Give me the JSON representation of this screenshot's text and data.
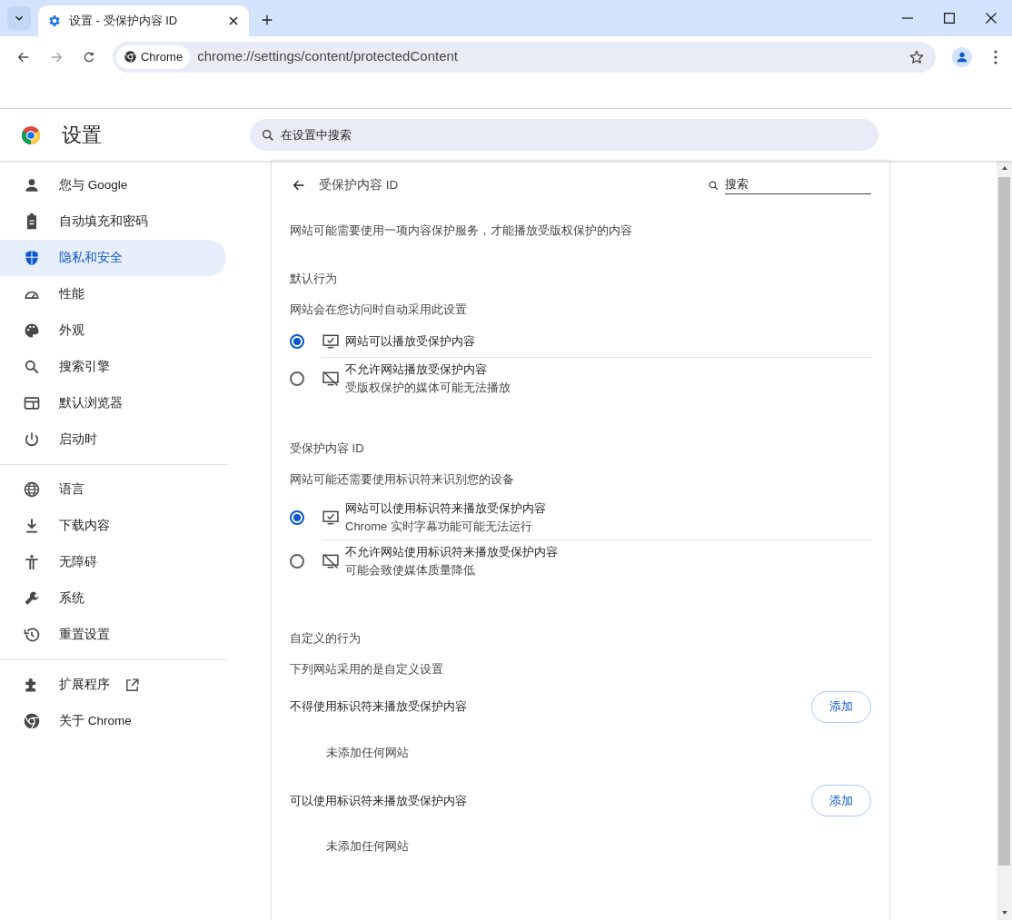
{
  "browser": {
    "tab": {
      "title": "设置 - 受保护内容 ID",
      "selected": true
    },
    "address": {
      "chip": "Chrome",
      "url": "chrome://settings/content/protectedContent"
    }
  },
  "header": {
    "title": "设置",
    "search": {
      "placeholder": "在设置中搜索"
    }
  },
  "sidebar": {
    "groups": [
      [
        {
          "label": "您与 Google",
          "selected": false,
          "external": false
        },
        {
          "label": "自动填充和密码",
          "selected": false,
          "external": false
        },
        {
          "label": "隐私和安全",
          "selected": true,
          "external": false
        },
        {
          "label": "性能",
          "selected": false,
          "external": false
        },
        {
          "label": "外观",
          "selected": false,
          "external": false
        },
        {
          "label": "搜索引擎",
          "selected": false,
          "external": false
        },
        {
          "label": "默认浏览器",
          "selected": false,
          "external": false
        },
        {
          "label": "启动时",
          "selected": false,
          "external": false
        }
      ],
      [
        {
          "label": "语言",
          "selected": false,
          "external": false
        },
        {
          "label": "下载内容",
          "selected": false,
          "external": false
        },
        {
          "label": "无障碍",
          "selected": false,
          "external": false
        },
        {
          "label": "系统",
          "selected": false,
          "external": false
        },
        {
          "label": "重置设置",
          "selected": false,
          "external": false
        }
      ],
      [
        {
          "label": "扩展程序",
          "selected": false,
          "external": true
        },
        {
          "label": "关于 Chrome",
          "selected": false,
          "external": false
        }
      ]
    ]
  },
  "page": {
    "title": "受保护内容 ID",
    "search": {
      "placeholder": "搜索"
    },
    "description": "网站可能需要使用一项内容保护服务，才能播放受版权保护的内容",
    "sections": [
      {
        "heading": "默认行为",
        "subheading": "网站会在您访问时自动采用此设置",
        "options": [
          {
            "kind": "allow",
            "selected": true,
            "title": "网站可以播放受保护内容"
          },
          {
            "kind": "block",
            "selected": false,
            "title": "不允许网站播放受保护内容",
            "subtitle": "受版权保护的媒体可能无法播放"
          }
        ]
      },
      {
        "heading": "受保护内容 ID",
        "subheading": "网站可能还需要使用标识符来识别您的设备",
        "options": [
          {
            "kind": "allow",
            "selected": true,
            "title": "网站可以使用标识符来播放受保护内容",
            "subtitle": "Chrome 实时字幕功能可能无法运行"
          },
          {
            "kind": "block",
            "selected": false,
            "title": "不允许网站使用标识符来播放受保护内容",
            "subtitle": "可能会致使媒体质量降低"
          }
        ]
      }
    ],
    "custom": {
      "heading": "自定义的行为",
      "subheading": "下列网站采用的是自定义设置",
      "lists": [
        {
          "title": "不得使用标识符来播放受保护内容",
          "button": "添加",
          "empty": "未添加任何网站"
        },
        {
          "title": "可以使用标识符来播放受保护内容",
          "button": "添加",
          "empty": "未添加任何网站"
        }
      ]
    }
  }
}
